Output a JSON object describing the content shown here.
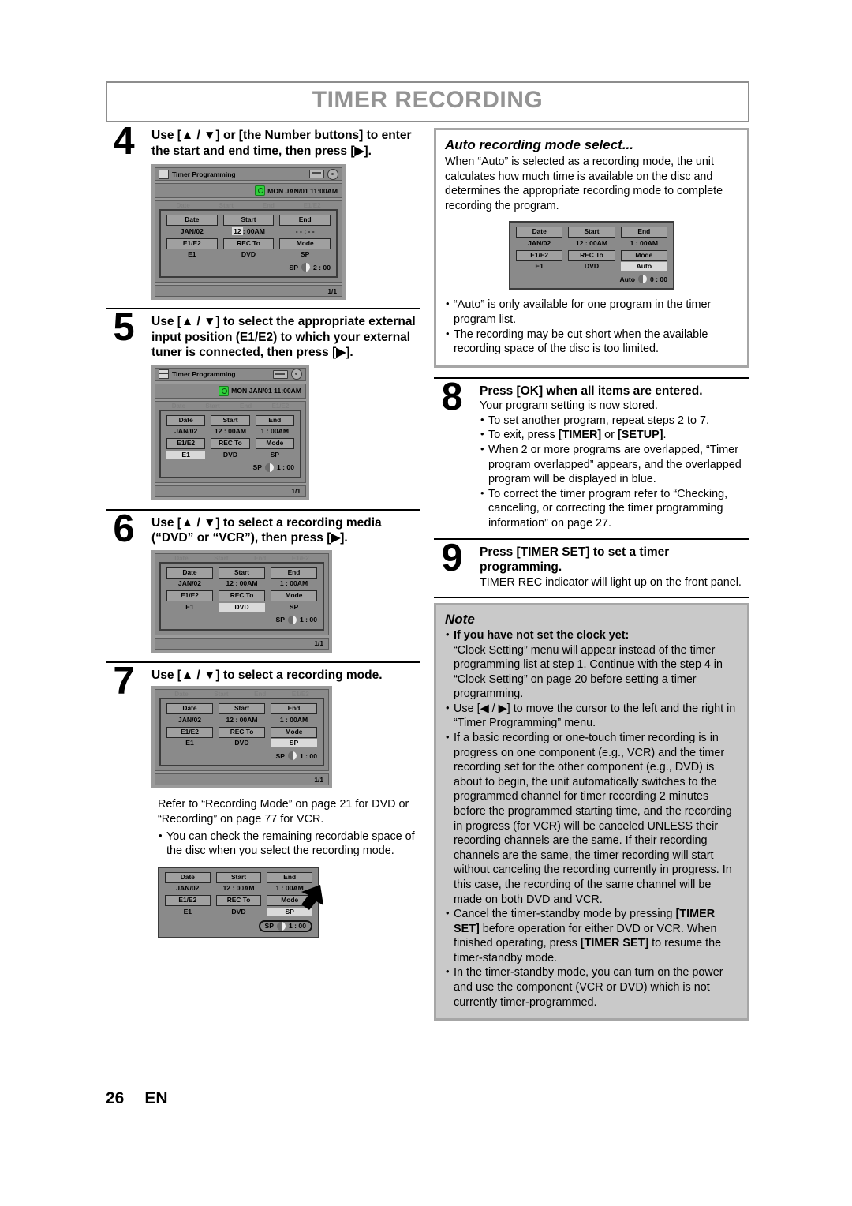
{
  "header": {
    "title": "TIMER RECORDING"
  },
  "footer": {
    "page_number": "26",
    "language": "EN"
  },
  "osd_common": {
    "window_title": "Timer Programming",
    "clock": "MON JAN/01 11:00AM",
    "page_indicator": "1/1",
    "headers": {
      "date": "Date",
      "start": "Start",
      "end": "End",
      "e1e2": "E1/E2",
      "recto": "REC To",
      "mode": "Mode"
    },
    "ghost_row": [
      "Date",
      "Start",
      "End",
      "E1/E2"
    ]
  },
  "steps": [
    {
      "number": "4",
      "heading": "Use [▲ / ▼] or [the Number buttons] to enter the start and end time, then press [▶].",
      "osd": {
        "date": "JAN/02",
        "start_prefix": "12",
        "start_suffix": ": 00AM",
        "end": "- - : - -",
        "e1e2": "E1",
        "recto": "DVD",
        "mode": "SP",
        "remaining_label": "SP",
        "remaining_time": "2 : 00",
        "selected": "start"
      }
    },
    {
      "number": "5",
      "heading": "Use [▲ / ▼] to select the appropriate external input position (E1/E2) to which your external tuner is connected, then press [▶].",
      "osd": {
        "date": "JAN/02",
        "start": "12 : 00AM",
        "end": "1 : 00AM",
        "e1e2": "E1",
        "recto": "DVD",
        "mode": "SP",
        "remaining_label": "SP",
        "remaining_time": "1 : 00",
        "selected": "e1e2"
      }
    },
    {
      "number": "6",
      "heading": "Use [▲ / ▼] to select a recording media (“DVD” or “VCR”), then press [▶].",
      "osd": {
        "date": "JAN/02",
        "start": "12 : 00AM",
        "end": "1 : 00AM",
        "e1e2": "E1",
        "recto": "DVD",
        "mode": "SP",
        "remaining_label": "SP",
        "remaining_time": "1 : 00",
        "selected": "recto"
      }
    },
    {
      "number": "7",
      "heading": "Use [▲ / ▼] to select a recording mode.",
      "osd": {
        "date": "JAN/02",
        "start": "12 : 00AM",
        "end": "1 : 00AM",
        "e1e2": "E1",
        "recto": "DVD",
        "mode": "SP",
        "remaining_label": "SP",
        "remaining_time": "1 : 00",
        "selected": "mode"
      },
      "after_text": "Refer to “Recording Mode” on page 21 for DVD or “Recording” on page 77 for VCR.",
      "after_bullet": "You can check the remaining recordable space of the disc when you select the recording mode.",
      "osd2": {
        "date": "JAN/02",
        "start": "12 : 00AM",
        "end": "1 : 00AM",
        "e1e2": "E1",
        "recto": "DVD",
        "mode": "SP",
        "remaining_label": "SP",
        "remaining_time": "1 : 00",
        "selected": "mode"
      }
    },
    {
      "number": "8",
      "heading": "Press [OK] when all items are entered.",
      "lead": "Your program setting is now stored.",
      "bullets": [
        "To set another program, repeat steps 2 to 7.",
        "To exit, press [TIMER] or [SETUP].",
        "When 2 or more programs are overlapped, “Timer program overlapped” appears, and the overlapped program will be displayed in blue.",
        "To correct the timer program refer to “Checking, canceling, or correcting the timer programming information” on page 27."
      ]
    },
    {
      "number": "9",
      "heading": "Press [TIMER SET] to set a timer programming.",
      "lead": "TIMER REC indicator will light up on the front panel."
    }
  ],
  "auto_box": {
    "title": "Auto recording mode select...",
    "body": "When “Auto” is selected as a recording mode, the unit calculates how much time is available on the disc and determines the appropriate recording mode to complete recording the program.",
    "osd": {
      "date": "JAN/02",
      "start": "12 : 00AM",
      "end": "1 : 00AM",
      "e1e2": "E1",
      "recto": "DVD",
      "mode": "Auto",
      "remaining_label": "Auto",
      "remaining_time": "0 : 00",
      "selected": "mode"
    },
    "bullets": [
      "“Auto” is only available for one program in the timer program list.",
      "The recording may be cut short when the available recording space of the disc is too limited."
    ]
  },
  "note_box": {
    "title": "Note",
    "first_bullet_bold": "If you have not set the clock yet:",
    "first_bullet_body": "“Clock Setting” menu will appear instead of the timer programming list at step 1. Continue with the step 4 in “Clock Setting” on page 20 before setting a timer programming.",
    "bullets": [
      "Use [◀ / ▶] to move the cursor to the left and the right in “Timer Programming” menu.",
      "If a basic recording or one-touch timer recording is in progress on one component (e.g., VCR) and the timer recording set for the other component (e.g., DVD) is about to begin, the unit automatically switches to the programmed channel for timer recording 2 minutes before the programmed starting time, and the recording in progress (for VCR) will be canceled UNLESS their recording channels are the same. If their recording channels are the same, the timer recording will start without canceling the recording currently in progress. In this case, the recording of the same channel will be made on both DVD and VCR.",
      "Cancel the timer-standby mode by pressing [TIMER SET] before operation for either DVD or VCR. When finished operating, press [TIMER SET] to resume the timer-standby mode.",
      "In the timer-standby mode, you can turn on the power and use the component (VCR or DVD) which is not currently timer-programmed."
    ]
  }
}
